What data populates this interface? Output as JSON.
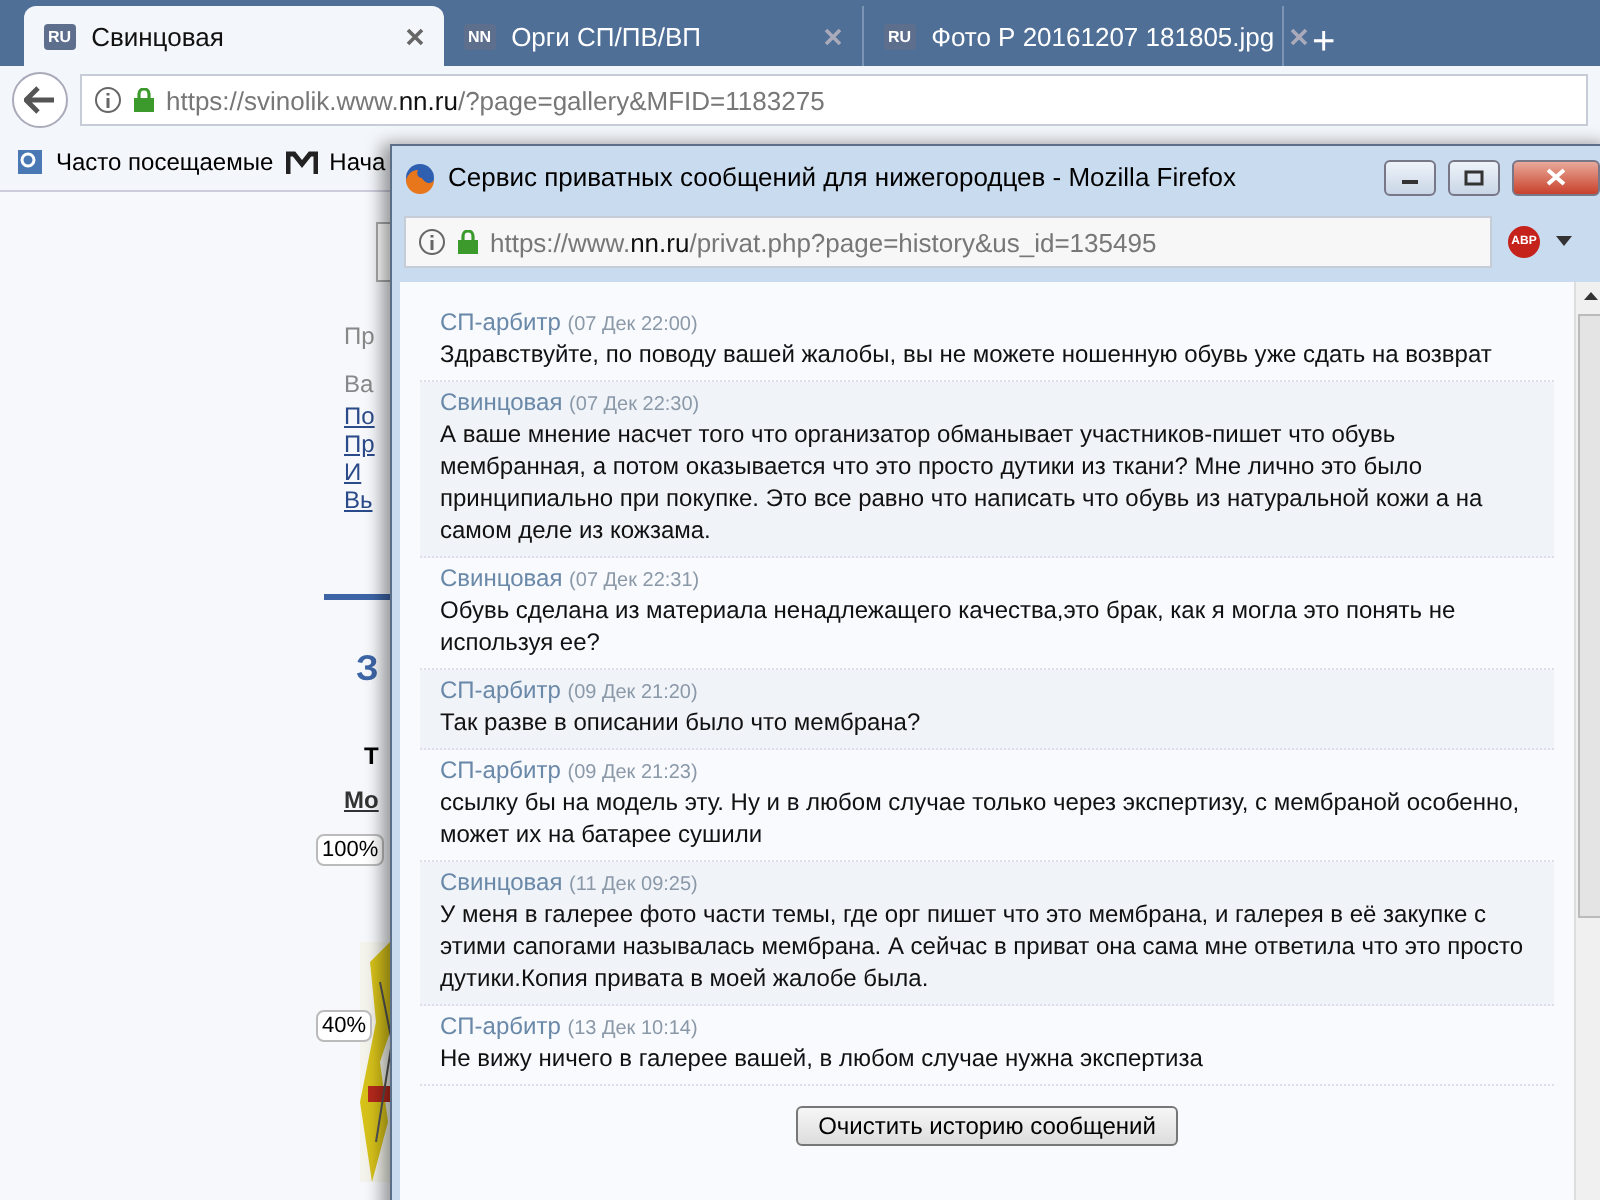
{
  "tabs": [
    {
      "icon": "RU",
      "label": "Свинцовая",
      "selected": true
    },
    {
      "icon": "NN",
      "label": "Орги СП/ПВ/ВП",
      "selected": false
    },
    {
      "icon": "RU",
      "label": "Фото Р 20161207 181805.jpg",
      "selected": false
    }
  ],
  "new_tab": "+",
  "address_bar": {
    "prefix": "https://svinolik.www.",
    "domain": "nn.ru",
    "suffix": "/?page=gallery&MFID=1183275"
  },
  "bookmarks": [
    "Часто посещаемые",
    "Нача"
  ],
  "background_page": {
    "texts": [
      {
        "kind": "grey",
        "text": "Пр"
      },
      {
        "kind": "grey",
        "text": "Ва"
      },
      {
        "kind": "link",
        "text": "По"
      },
      {
        "kind": "link",
        "text": "Пр"
      },
      {
        "kind": "link",
        "text": "И"
      },
      {
        "kind": "link",
        "text": "Вь"
      },
      {
        "kind": "heading",
        "text": "З"
      },
      {
        "kind": "bold",
        "text": "Т"
      },
      {
        "kind": "boldlink",
        "text": "Мо"
      }
    ],
    "zoom_labels": [
      "100%",
      "40%"
    ]
  },
  "popup": {
    "title": "Сервис приватных сообщений для нижегородцев - Mozilla Firefox",
    "url": {
      "prefix": "https://www.",
      "domain": "nn.ru",
      "suffix": "/privat.php?page=history&us_id=135495"
    },
    "addon_badge": "ABP",
    "messages": [
      {
        "author": "СП-арбитр",
        "time": "(07 Дек 22:00)",
        "text": "Здравствуйте, по поводу вашей жалобы, вы не можете ношенную обувь уже сдать на возврат"
      },
      {
        "author": "Свинцовая",
        "time": "(07 Дек 22:30)",
        "text": "А ваше мнение насчет того что организатор обманывает участников-пишет что обувь мембранная, а потом оказывается что это просто дутики из ткани? Мне лично это было принципиально при покупке. Это все равно что написать что обувь из натуральной кожи а на самом деле из кожзама."
      },
      {
        "author": "Свинцовая",
        "time": "(07 Дек 22:31)",
        "text": "Обувь сделана из материала ненадлежащего качества,это брак, как я могла это понять не используя ее?"
      },
      {
        "author": "СП-арбитр",
        "time": "(09 Дек 21:20)",
        "text": "Так разве в описании было что мембрана?"
      },
      {
        "author": "СП-арбитр",
        "time": "(09 Дек 21:23)",
        "text": "ссылку бы на модель эту. Ну и в любом случае только через экспертизу, с мембраной особенно, может их на батарее сушили"
      },
      {
        "author": "Свинцовая",
        "time": "(11 Дек 09:25)",
        "text": "У меня в галерее фото части темы, где орг пишет что это мембрана, и галерея в её закупке с этими сапогами называлась мембрана. А сейчас в приват она сама мне ответила что это просто дутики.Копия привата в моей жалобе была."
      },
      {
        "author": "СП-арбитр",
        "time": "(13 Дек 10:14)",
        "text": "Не вижу ничего в галерее вашей, в любом случае нужна экспертиза"
      }
    ],
    "clear_button": "Очистить историю сообщений"
  }
}
